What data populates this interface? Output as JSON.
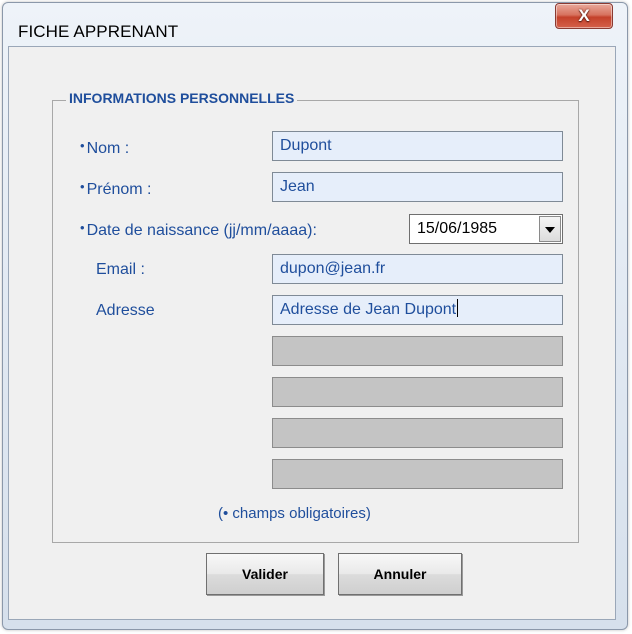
{
  "window": {
    "title": "FICHE APPRENANT",
    "close_glyph": "X"
  },
  "group": {
    "legend": "INFORMATIONS PERSONNELLES"
  },
  "required_mark": "•",
  "fields": {
    "nom": {
      "label": "Nom :",
      "value": "Dupont",
      "required": true
    },
    "prenom": {
      "label": "Prénom :",
      "value": "Jean",
      "required": true
    },
    "date_naissance": {
      "label": "Date de naissance (jj/mm/aaaa):",
      "value": "15/06/1985",
      "required": true
    },
    "email": {
      "label": "Email :",
      "value": "dupon@jean.fr",
      "required": false
    },
    "adresse": {
      "label": "Adresse",
      "lines": [
        "Adresse de Jean Dupont",
        "",
        "",
        "",
        ""
      ],
      "required": false
    }
  },
  "footnote": "(• champs obligatoires)",
  "buttons": {
    "valider": "Valider",
    "annuler": "Annuler"
  },
  "colors": {
    "label_blue": "#1f4e9c",
    "field_bg": "#e6eefa",
    "field_disabled_bg": "#c4c4c4",
    "close_red": "#c4412b"
  },
  "icons": {
    "close": "close-icon",
    "dropdown": "chevron-down-icon"
  }
}
